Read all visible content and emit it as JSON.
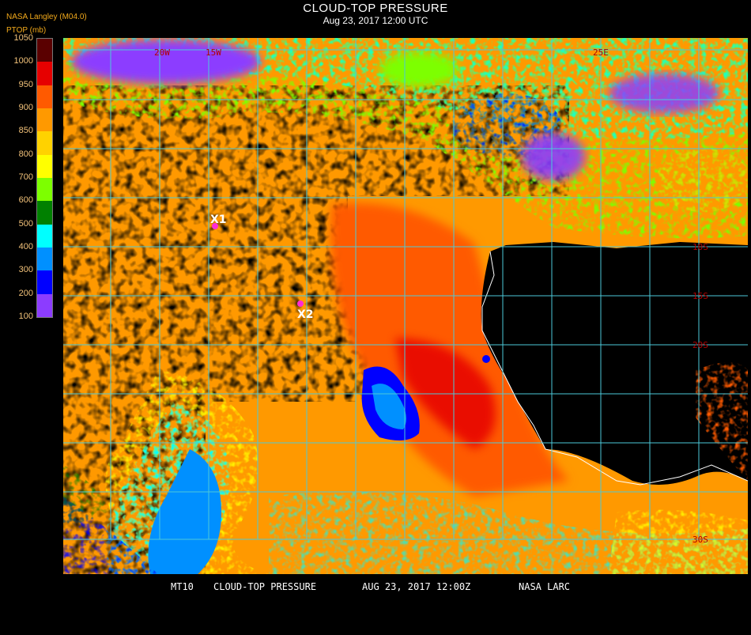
{
  "header": {
    "title": "CLOUD-TOP PRESSURE",
    "subtitle": "Aug 23, 2017 12:00 UTC",
    "source": "NASA Langley (M04.0)",
    "unit": "PTOP (mb)"
  },
  "colorbar": {
    "labels": [
      "1050",
      "1000",
      "950",
      "900",
      "850",
      "800",
      "700",
      "600",
      "500",
      "400",
      "300",
      "200",
      "100"
    ],
    "colors": [
      "#5a0000",
      "#e60000",
      "#ff5a00",
      "#ff9900",
      "#ffd200",
      "#ffff00",
      "#7dff00",
      "#008000",
      "#00ffff",
      "#0090ff",
      "#0000ff",
      "#8c3cff"
    ]
  },
  "map": {
    "grid_lat_labels": [
      "10S",
      "15S",
      "20S",
      "30S"
    ],
    "grid_lon_labels": [
      "20W",
      "15W",
      "25E"
    ],
    "markers": [
      {
        "label": "X1"
      },
      {
        "label": "X2"
      }
    ]
  },
  "footer": {
    "product": "MT10",
    "name": "CLOUD-TOP PRESSURE",
    "date": "AUG 23, 2017 12:00Z",
    "org": "NASA LARC"
  }
}
